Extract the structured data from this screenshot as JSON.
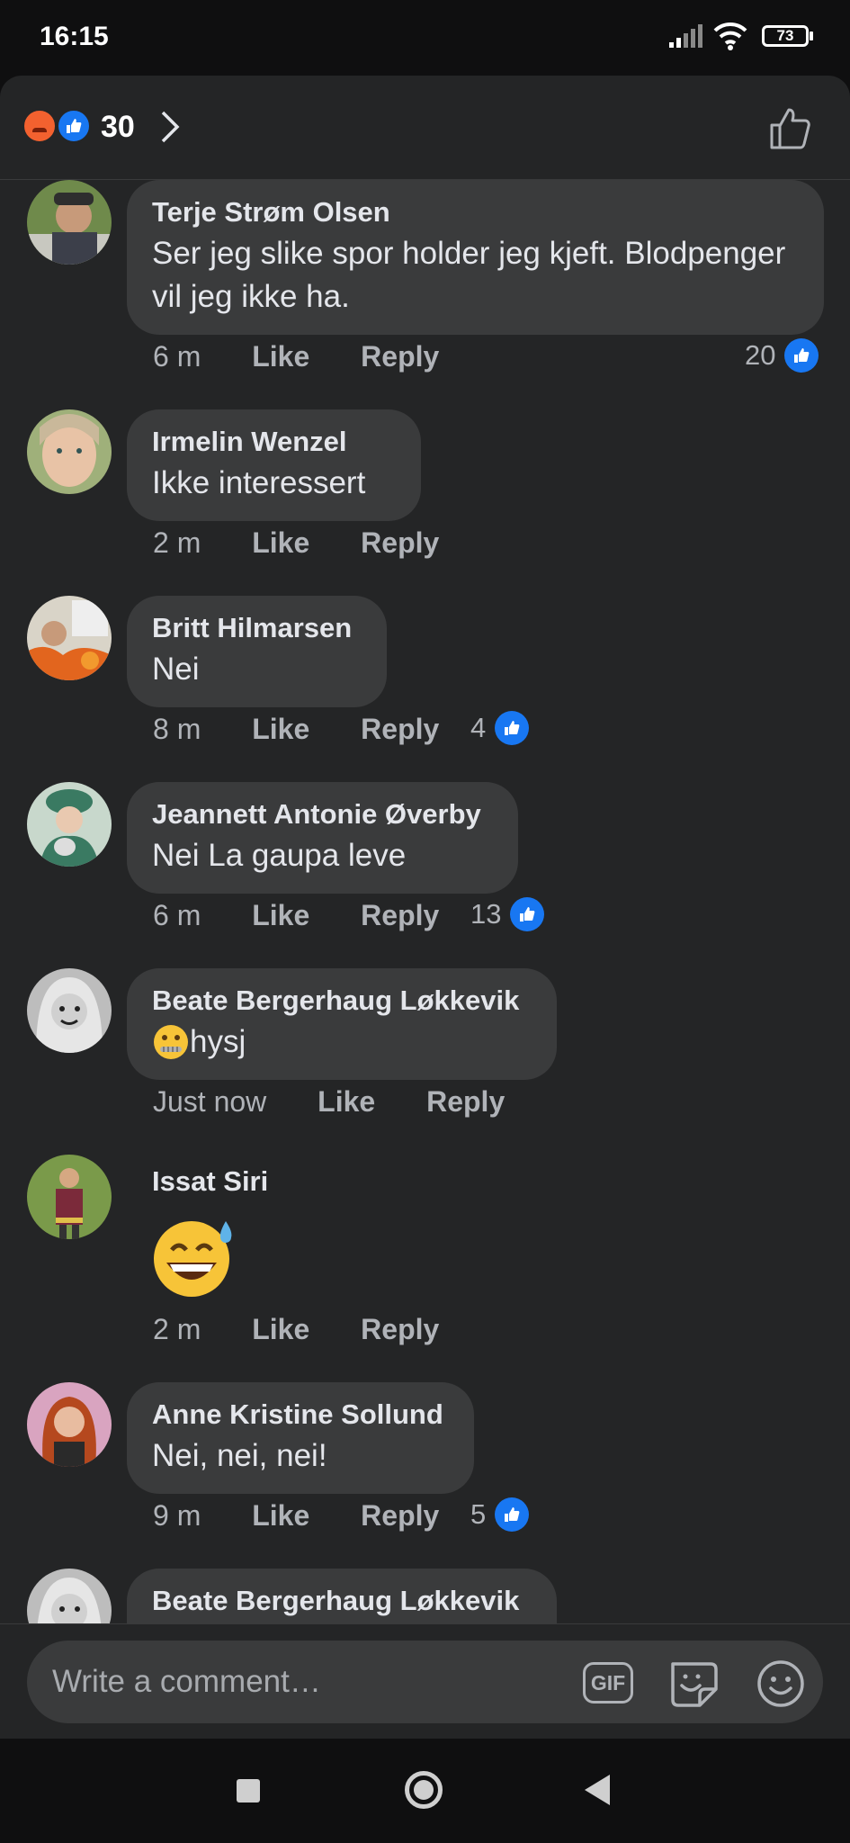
{
  "status_bar": {
    "time": "16:15",
    "battery": "73"
  },
  "header": {
    "reaction_count": "30",
    "reaction_icons": [
      "angry-icon",
      "like-icon"
    ]
  },
  "comments": [
    {
      "name": "Terje Strøm Olsen",
      "text": "Ser jeg slike spor holder jeg kjeft. Blodpenger vil jeg ikke ha.",
      "time": "6 m",
      "like": "Like",
      "reply": "Reply",
      "likes": "20"
    },
    {
      "name": "Irmelin Wenzel",
      "text": "Ikke interessert",
      "time": "2 m",
      "like": "Like",
      "reply": "Reply"
    },
    {
      "name": "Britt Hilmarsen",
      "text": "Nei",
      "time": "8 m",
      "like": "Like",
      "reply": "Reply",
      "likes": "4"
    },
    {
      "name": "Jeannett Antonie Øverby",
      "text": "Nei La gaupa leve",
      "time": "6 m",
      "like": "Like",
      "reply": "Reply",
      "likes": "13"
    },
    {
      "name": "Beate Bergerhaug Løkkevik",
      "text": "hysj",
      "emoji": "zipper-mouth-face-icon",
      "time": "Just now",
      "like": "Like",
      "reply": "Reply"
    },
    {
      "name": "Issat Siri",
      "emoji": "grinning-sweat-face-icon",
      "time": "2 m",
      "like": "Like",
      "reply": "Reply"
    },
    {
      "name": "Anne Kristine Sollund",
      "text": "Nei, nei, nei!",
      "time": "9 m",
      "like": "Like",
      "reply": "Reply",
      "likes": "5"
    },
    {
      "name": "Beate Bergerhaug Løkkevik"
    }
  ],
  "composer": {
    "placeholder": "Write a comment…",
    "gif_label": "GIF"
  },
  "colors": {
    "like_blue": "#1877f2",
    "bubble": "#3a3b3c",
    "sheet": "#242526",
    "meta": "#b0b3b8"
  }
}
